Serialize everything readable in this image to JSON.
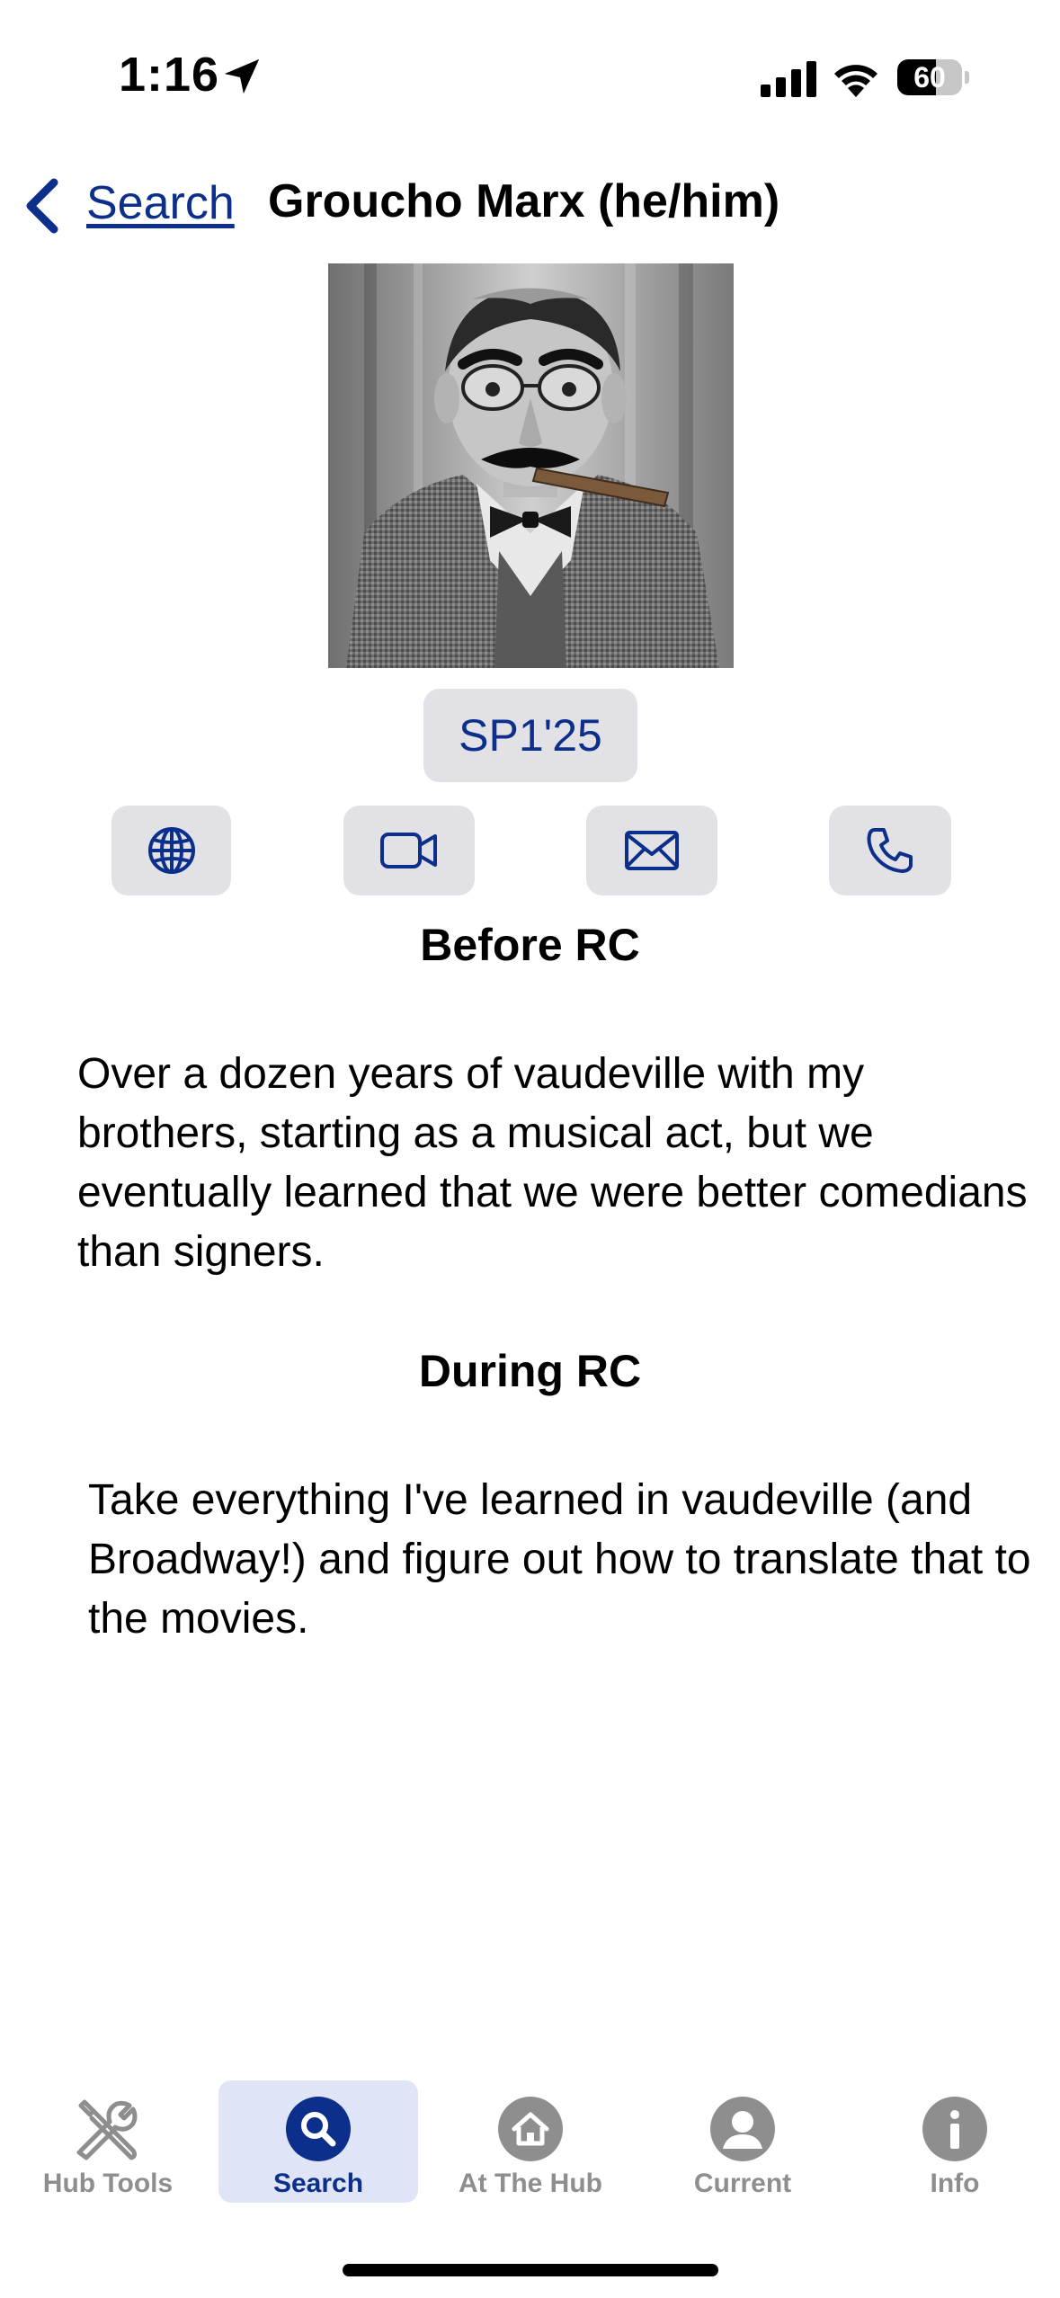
{
  "status_bar": {
    "time": "1:16",
    "battery_level": "60",
    "battery_fraction": 0.6
  },
  "nav": {
    "back_label": "Search",
    "title": "Groucho Marx (he/him)"
  },
  "profile": {
    "cohort": "SP1'25",
    "contact_icons": [
      "globe-icon",
      "video-camera-icon",
      "envelope-icon",
      "phone-icon"
    ],
    "sections": [
      {
        "heading": "Before RC",
        "body": "Over a dozen years of vaudeville with my brothers, starting as a musical act, but we eventually learned that we were better comedians than signers."
      },
      {
        "heading": "During RC",
        "body": "Take everything I've learned in vaudeville (and Broadway!) and figure out how to translate that to the movies."
      }
    ]
  },
  "tab_bar": {
    "tabs": [
      {
        "label": "Hub Tools",
        "icon": "tools-icon",
        "active": false
      },
      {
        "label": "Search",
        "icon": "search-icon",
        "active": true
      },
      {
        "label": "At The Hub",
        "icon": "home-icon",
        "active": false
      },
      {
        "label": "Current",
        "icon": "person-icon",
        "active": false
      },
      {
        "label": "Info",
        "icon": "info-icon",
        "active": false
      }
    ]
  },
  "colors": {
    "accent": "#0b2f8a",
    "button_bg": "#e2e2e6",
    "tab_inactive": "#8e8e8e",
    "tab_active_bg": "#dfe4f6"
  }
}
